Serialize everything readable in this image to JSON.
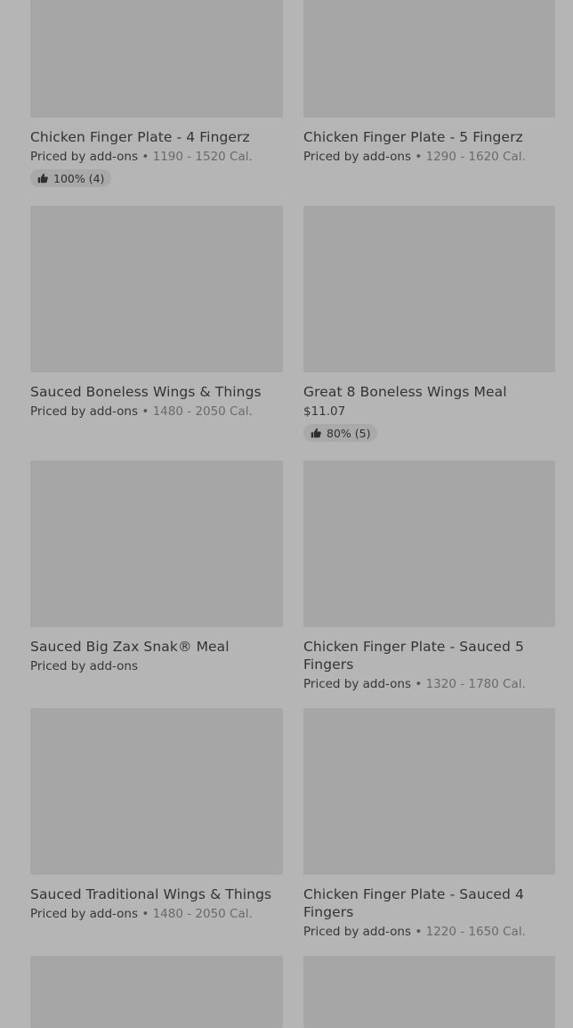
{
  "items": [
    {
      "title": "Chicken Finger Plate - 4 Fingerz",
      "price": "Priced by add-ons",
      "cal": "1190 - 1520 Cal.",
      "rating": "100% (4)"
    },
    {
      "title": "Chicken Finger Plate - 5 Fingerz",
      "price": "Priced by add-ons",
      "cal": "1290 - 1620 Cal."
    },
    {
      "title": "Sauced Boneless Wings & Things",
      "price": "Priced by add-ons",
      "cal": "1480 - 2050 Cal."
    },
    {
      "title": "Great 8 Boneless Wings Meal",
      "price": "$11.07",
      "rating": "80% (5)"
    },
    {
      "title": "Sauced Big Zax Snak® Meal",
      "price": "Priced by add-ons"
    },
    {
      "title": "Chicken Finger Plate - Sauced 5 Fingers",
      "price": "Priced by add-ons",
      "cal": "1320 - 1780 Cal."
    },
    {
      "title": "Sauced Traditional Wings & Things",
      "price": "Priced by add-ons",
      "cal": "1480 - 2050 Cal."
    },
    {
      "title": "Chicken Finger Plate - Sauced 4 Fingers",
      "price": "Priced by add-ons",
      "cal": "1220 - 1650 Cal."
    }
  ],
  "separator": "•",
  "icons": {
    "rating": "thumbs-up-icon"
  },
  "colors": {
    "background": "#b5b5b5",
    "image_placeholder": "#a6a6a6",
    "badge": "#a9a9a9"
  }
}
